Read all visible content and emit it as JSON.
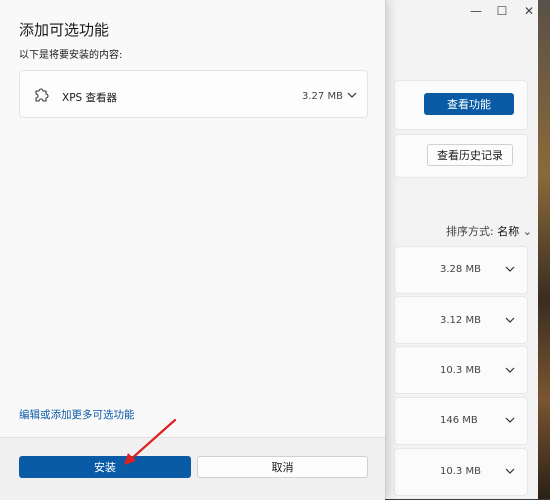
{
  "background_window": {
    "window_buttons": [
      "—",
      "☐",
      "✕"
    ],
    "view_features_button": "查看功能",
    "view_history_button": "查看历史记录",
    "sort_label": "排序方式:",
    "sort_value": "名称",
    "feature_sizes": [
      "3.28 MB",
      "3.12 MB",
      "10.3 MB",
      "146 MB",
      "10.3 MB"
    ]
  },
  "dialog": {
    "title": "添加可选功能",
    "subtitle": "以下是将要安装的内容:",
    "item": {
      "name": "XPS 查看器",
      "size": "3.27 MB",
      "icon": "puzzle-piece-icon"
    },
    "more_link": "编辑或添加更多可选功能",
    "install_button": "安装",
    "cancel_button": "取消"
  },
  "colors": {
    "accent": "#0a5ba6",
    "annotation_arrow": "#e02020"
  }
}
